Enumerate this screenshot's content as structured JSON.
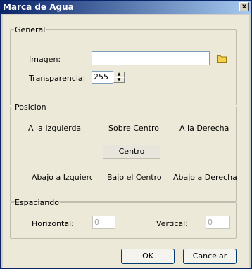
{
  "window": {
    "title": "Marca de Agua",
    "close_glyph": "x"
  },
  "general": {
    "legend": "General",
    "image_label": "Imagen:",
    "image_value": "",
    "transparency_label": "Transparencia:",
    "transparency_value": "255"
  },
  "posicion": {
    "legend": "Posicion",
    "left": "A la Izquierda",
    "over_center": "Sobre Centro",
    "right": "A la Derecha",
    "center": "Centro",
    "bottom_left": "Abajo a Izquierda",
    "bottom_center": "Bajo el Centro",
    "bottom_right": "Abajo a Derecha"
  },
  "espaciando": {
    "legend": "Espaciando",
    "horizontal_label": "Horizontal:",
    "horizontal_value": "0",
    "vertical_label": "Vertical:",
    "vertical_value": "0"
  },
  "buttons": {
    "ok": "OK",
    "cancel": "Cancelar"
  },
  "icons": {
    "browse": "folder-icon",
    "close": "close-icon"
  }
}
